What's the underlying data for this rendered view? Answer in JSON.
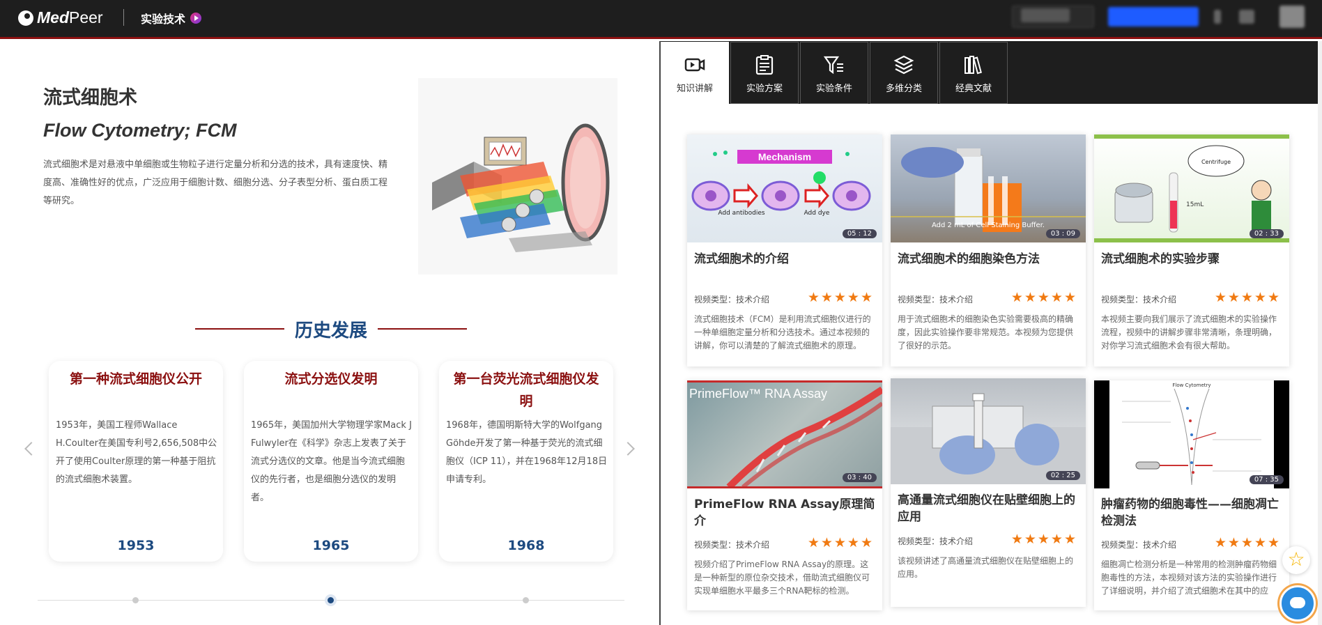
{
  "header": {
    "brand_bold": "Med",
    "brand_rest": "Peer",
    "section": "实验技术"
  },
  "intro": {
    "title": "流式细胞术",
    "subtitle": "Flow Cytometry; FCM",
    "description": "流式细胞术是对悬液中单细胞或生物粒子进行定量分析和分选的技术，具有速度快、精度高、准确性好的优点，广泛应用于细胞计数、细胞分选、分子表型分析、蛋白质工程等研究。"
  },
  "history": {
    "heading": "历史发展",
    "cards": [
      {
        "title": "第一种流式细胞仪公开",
        "text": "1953年，美国工程师Wallace H.Coulter在美国专利号2,656,508中公开了使用Coulter原理的第一种基于阻抗的流式细胞术装置。",
        "year": "1953"
      },
      {
        "title": "流式分选仪发明",
        "text": "1965年，美国加州大学物理学家Mack J Fulwyler在《科学》杂志上发表了关于流式分选仪的文章。他是当今流式细胞仪的先行者，也是细胞分选仪的发明者。",
        "year": "1965"
      },
      {
        "title": "第一台荧光流式细胞仪发明",
        "text": "1968年，德国明斯特大学的Wolfgang Göhde开发了第一种基于荧光的流式细胞仪（ICP 11），并在1968年12月18日申请专利。",
        "year": "1968"
      }
    ]
  },
  "tabs": [
    {
      "label": "知识讲解",
      "icon": "video-icon"
    },
    {
      "label": "实验方案",
      "icon": "clipboard-icon"
    },
    {
      "label": "实验条件",
      "icon": "filter-icon"
    },
    {
      "label": "多维分类",
      "icon": "layers-icon"
    },
    {
      "label": "经典文献",
      "icon": "books-icon"
    }
  ],
  "videos": [
    {
      "title": "流式细胞术的介绍",
      "type": "视频类型：技术介绍",
      "stars": "★★★★★",
      "duration": "05 : 12",
      "desc": "流式细胞技术（FCM）是利用流式细胞仪进行的一种单细胞定量分析和分选技术。通过本视频的讲解，你可以清楚的了解流式细胞术的原理。",
      "thumb_text": "Mechanism",
      "thumb_text2": "Add antibodies",
      "thumb_text3": "Add dye"
    },
    {
      "title": "流式细胞术的细胞染色方法",
      "type": "视频类型：技术介绍",
      "stars": "★★★★★",
      "duration": "03 : 09",
      "desc": "用于流式细胞术的细胞染色实验需要极高的精确度，因此实验操作要非常规范。本视频为您提供了很好的示范。",
      "thumb_text": "Add 2 mL of Cell Staining Buffer."
    },
    {
      "title": "流式细胞术的实验步骤",
      "type": "视频类型：技术介绍",
      "stars": "★★★★★",
      "duration": "02 : 33",
      "desc": "本视频主要向我们展示了流式细胞术的实验操作流程，视频中的讲解步骤非常清晰，条理明确，对你学习流式细胞术会有很大帮助。",
      "thumb_text": "Centrifuge",
      "thumb_text2": "15mL"
    },
    {
      "title": "PrimeFlow RNA Assay原理简介",
      "type": "视频类型：技术介绍",
      "stars": "★★★★★",
      "duration": "03 : 40",
      "desc": "视频介绍了PrimeFlow RNA Assay的原理。这是一种新型的原位杂交技术，借助流式细胞仪可实现单细胞水平最多三个RNA靶标的检测。",
      "thumb_text": "PrimeFlow™ RNA Assay"
    },
    {
      "title": "高通量流式细胞仪在贴壁细胞上的应用",
      "type": "视频类型：技术介绍",
      "stars": "★★★★★",
      "duration": "02 : 25",
      "desc": "该视频讲述了高通量流式细胞仪在贴壁细胞上的应用。"
    },
    {
      "title": "肿瘤药物的细胞毒性——细胞凋亡检测法",
      "type": "视频类型：技术介绍",
      "stars": "★★★★★",
      "duration": "07 : 35",
      "desc": "细胞凋亡检测分析是一种常用的检测肿瘤药物细胞毒性的方法，本视频对该方法的实验操作进行了详细说明，并介绍了流式细胞术在其中的应用。",
      "thumb_text": "Flow Cytometry"
    }
  ],
  "colors": {
    "accent_red": "#8b1010",
    "accent_blue": "#1d4a80",
    "star": "#f07a12"
  }
}
